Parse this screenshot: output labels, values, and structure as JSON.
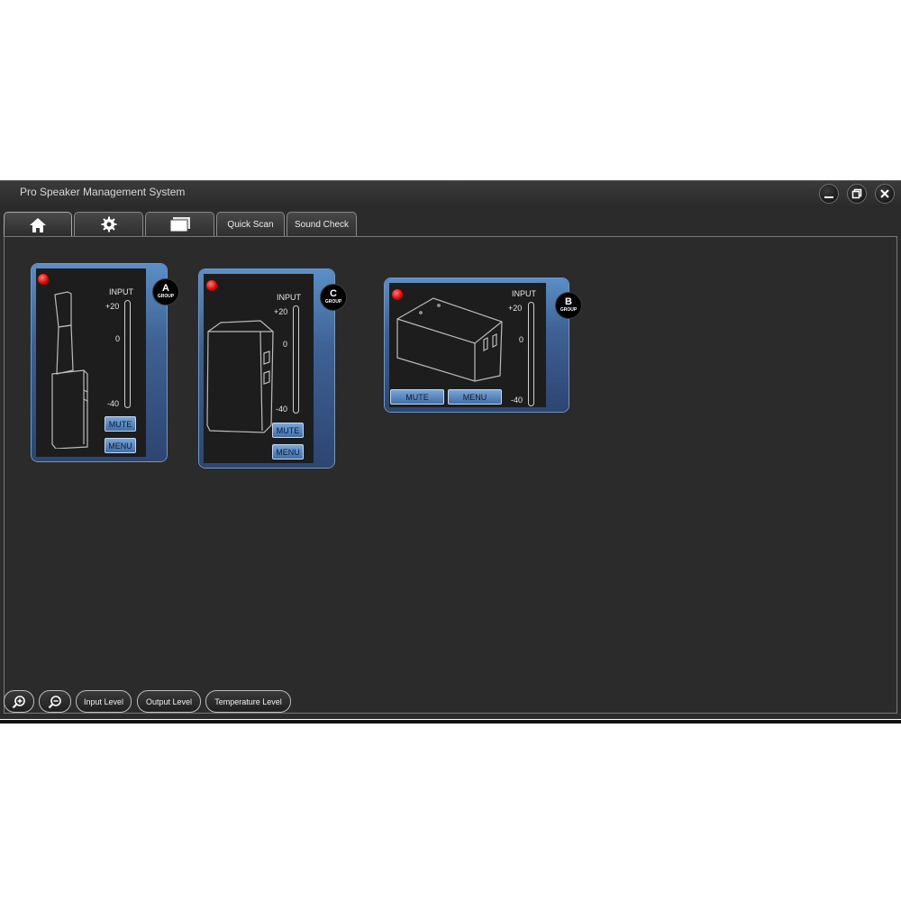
{
  "window": {
    "title": "Pro Speaker Management System"
  },
  "tabs": [
    {
      "icon": "home-icon"
    },
    {
      "icon": "gear-icon"
    },
    {
      "icon": "windows-icon"
    },
    {
      "label": "Quick Scan"
    },
    {
      "label": "Sound Check"
    }
  ],
  "devices": [
    {
      "group": "A",
      "group_label": "GROUP",
      "input_label": "INPUT",
      "scale_top": "+20",
      "scale_mid": "0",
      "scale_bottom": "-40",
      "mute_label": "MUTE",
      "menu_label": "MENU",
      "status_color": "#e00000"
    },
    {
      "group": "C",
      "group_label": "GROUP",
      "input_label": "INPUT",
      "scale_top": "+20",
      "scale_mid": "0",
      "scale_bottom": "-40",
      "mute_label": "MUTE",
      "menu_label": "MENU",
      "status_color": "#e00000"
    },
    {
      "group": "B",
      "group_label": "GROUP",
      "input_label": "INPUT",
      "scale_top": "+20",
      "scale_mid": "0",
      "scale_bottom": "-40",
      "mute_label": "MUTE",
      "menu_label": "MENU",
      "status_color": "#e00000"
    }
  ],
  "toolbar": {
    "zoom_in_icon": "zoom-in-icon",
    "zoom_out_icon": "zoom-out-icon",
    "input_level": "Input Level",
    "output_level": "Output Level",
    "temperature_level": "Temperature Level"
  }
}
